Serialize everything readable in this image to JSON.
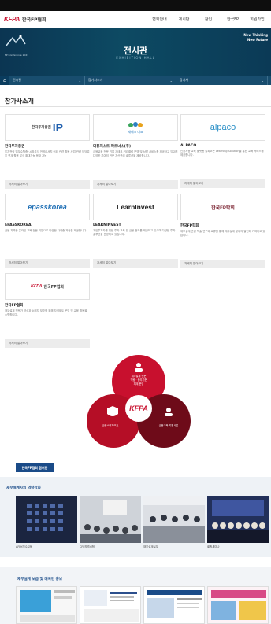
{
  "brand": {
    "mark": "KFPA",
    "name": "한국FP협회",
    "sub": "Korea Financial Planning Association"
  },
  "nav": {
    "items": [
      "협회안내",
      "게시판",
      "참인",
      "한국FP",
      "회원가입"
    ]
  },
  "hero": {
    "title": "전시관",
    "subtitle": "EXHIBITION HALL",
    "tagline_line1": "New Thinking",
    "tagline_line2": "New Future",
    "left_caption": "FP Conference 2023"
  },
  "breadcrumb": {
    "home_icon": "home-icon",
    "items": [
      "전시관",
      "참가사소개",
      "참가사"
    ]
  },
  "section": {
    "title": "참가사소개"
  },
  "cards": [
    {
      "logo_text": "한국투자증권",
      "logo_sub": "",
      "name": "한국투자증권",
      "desc": "투자전략 업무수행중 ·시장분석 전략리서치 이외 관련 활동 사업 관련\n담당업무 연계 활용 분석 확대가능 응대 가능",
      "button": "자세히 알아보기"
    },
    {
      "logo_text": "재테크 대표",
      "logo_sub": "",
      "name": "더퓨처스트 파트너스(주)",
      "desc": "금융교육 전문 기업 재테크 커리큘럼 운영 및 상담 서비스를 제공하고 있으며 다양한 분야의 전문 자산관리 솔루션을 제공합니다.",
      "button": "자세히 알아보기"
    },
    {
      "logo_text": "alpaco",
      "logo_sub": "",
      "name": "ALPACO",
      "desc": "인공지능 교육 플랫폼 알파코는 Learning Solution을 통한 교육 서비스를 제공합니다.",
      "button": "자세히 알아보기"
    },
    {
      "logo_text": "epasskorea",
      "logo_sub": "",
      "name": "EPASSKOREA",
      "desc": "금융 자격증 온라인 교육 전문 기업으로 다양한 자격증 과정을 제공합니다.",
      "button": "자세히 알아보기"
    },
    {
      "logo_text": "LearnInvest",
      "logo_sub": "",
      "name": "LEARNINVEST",
      "desc": "개인투자자를 위한 투자 교육 및 금융 정보를 제공하고 있으며 다양한 투자 솔루션을 운영하고 있습니다.",
      "button": "자세히 알아보기"
    },
    {
      "logo_text": "한국FP학회",
      "logo_sub": "",
      "name": "한국FP학회",
      "desc": "재무설계 관련 학술 연구와 교류를 통해 재무설계 분야의 발전에 기여하고 있습니다.",
      "button": "자세히 알아보기"
    },
    {
      "logo_text": "한국FP협회",
      "logo_sub": "",
      "name": "한국FP협회",
      "desc": "재무설계 전문가 양성과 소비자 보호를 위해 자격제도 운영 및 교육 활동을 수행합니다.",
      "button": "자세히 알아보기"
    }
  ],
  "venn": {
    "center": "KFPA",
    "top_lines": [
      "재무설계 전문",
      "역량 · 윤리기준",
      "체계 운영"
    ],
    "left_label": "금융소비자보호",
    "right_label": "금융교육 지원사업"
  },
  "kfpa_button": "한국FP협회 참여단",
  "band1": {
    "title": "재무설계사의 역량강화",
    "captions": [
      "AFPK연수교육",
      "CFP자격시험",
      "재무설계실무",
      "회원세미나"
    ]
  },
  "band2": {
    "title": "재무설계 보급 및 대국민 홍보"
  },
  "colors": {
    "hero": "#0b3552",
    "crumb": "#184d6e",
    "accent": "#c8102e",
    "venn_red": "#c8102e",
    "venn_dark": "#8b0d1f"
  }
}
